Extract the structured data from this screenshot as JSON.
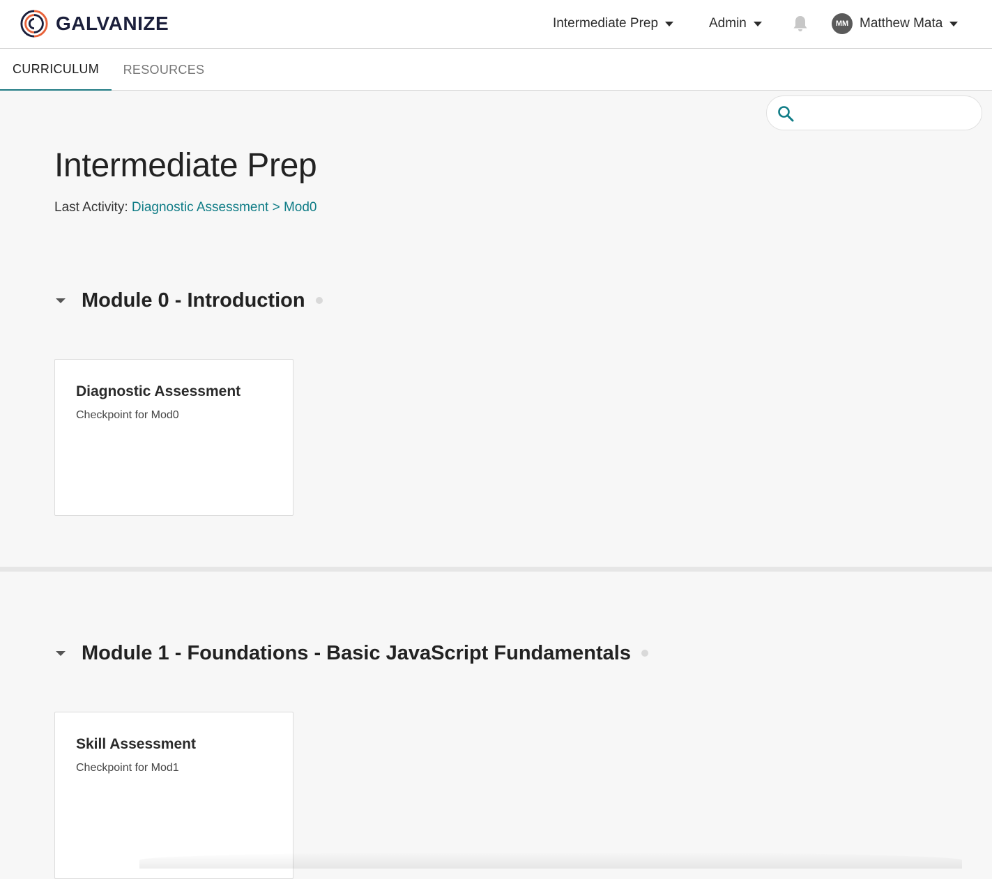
{
  "header": {
    "brand": "GALVANIZE",
    "program_menu": "Intermediate Prep",
    "admin_menu": "Admin",
    "user": {
      "initials": "MM",
      "name": "Matthew Mata"
    }
  },
  "tabs": [
    {
      "label": "CURRICULUM",
      "active": true
    },
    {
      "label": "RESOURCES",
      "active": false
    }
  ],
  "search": {
    "placeholder": "",
    "value": ""
  },
  "page": {
    "title": "Intermediate Prep",
    "last_activity_label": "Last Activity:",
    "last_activity_link": "Diagnostic Assessment > Mod0"
  },
  "modules": [
    {
      "title": "Module 0 - Introduction",
      "cards": [
        {
          "title": "Diagnostic Assessment",
          "subtitle": "Checkpoint for Mod0"
        }
      ]
    },
    {
      "title": "Module 1 - Foundations - Basic JavaScript Fundamentals",
      "cards": [
        {
          "title": "Skill Assessment",
          "subtitle": "Checkpoint for Mod1"
        }
      ]
    }
  ],
  "colors": {
    "accent": "#0f7c86",
    "brand_navy": "#1b1f3b",
    "brand_orange": "#e8623a",
    "background": "#f7f7f7"
  },
  "icons": {
    "logo": "galvanize-logo-icon",
    "bell": "bell-icon",
    "search": "search-icon",
    "caret": "caret-down-icon"
  }
}
